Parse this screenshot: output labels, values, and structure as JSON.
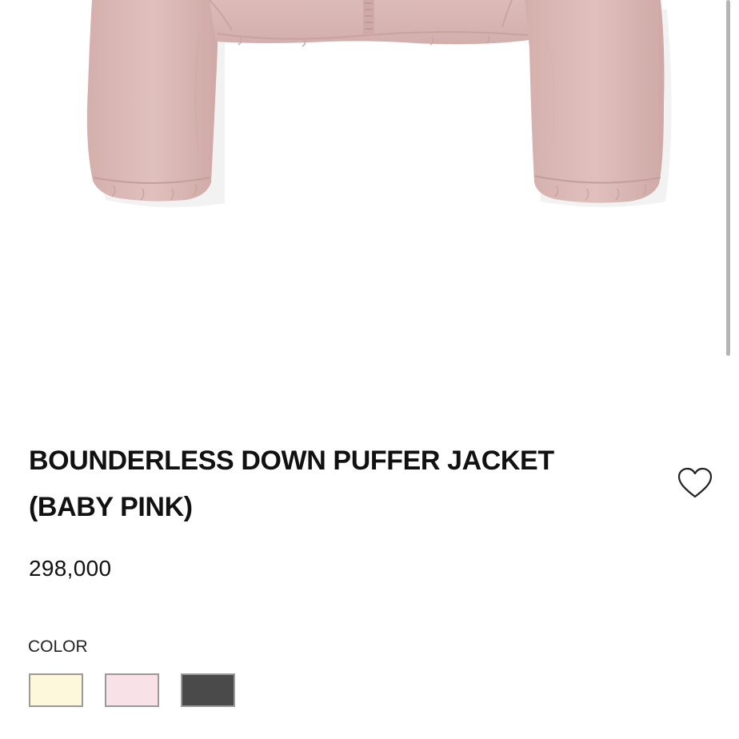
{
  "product": {
    "title_line_1": "BOUNDERLESS DOWN PUFFER JACKET",
    "title_line_2": "(BABY PINK)",
    "price": "298,000",
    "image_subject": "baby pink cropped down puffer jacket"
  },
  "wishlist": {
    "icon": "heart-outline-icon"
  },
  "color_selector": {
    "label": "COLOR",
    "swatches": [
      {
        "color": "#fdf7dc"
      },
      {
        "color": "#f8e1e7"
      },
      {
        "color": "#4a4a4a"
      }
    ]
  },
  "colors": {
    "jacket": "#ddbcb9",
    "jacket_shadow": "#c9a3a0",
    "text": "#111111",
    "swatch_border": "#9a9a9a"
  }
}
